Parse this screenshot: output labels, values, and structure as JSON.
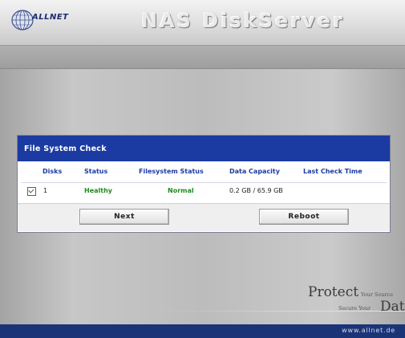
{
  "header": {
    "brand": "ALLNET",
    "app_title": "NAS DiskServer"
  },
  "panel": {
    "title": "File System Check",
    "columns": [
      "Disks",
      "Status",
      "Filesystem Status",
      "Data Capacity",
      "Last Check Time"
    ],
    "rows": [
      {
        "checked": true,
        "disk": "1",
        "status": "Healthy",
        "filesystem_status": "Normal",
        "data_capacity": "0.2 GB / 65.9 GB",
        "last_check_time": ""
      }
    ],
    "buttons": {
      "next": "Next",
      "reboot": "Reboot"
    }
  },
  "slogan": {
    "protect": "Protect",
    "your_source": "Your Source",
    "secure_your": "Secure Your",
    "data": "Data"
  },
  "footer": {
    "url": "www.allnet.de"
  },
  "colors": {
    "panel_header": "#1b3ba2",
    "status_ok": "#1f8a1f",
    "footer": "#1b3478"
  }
}
